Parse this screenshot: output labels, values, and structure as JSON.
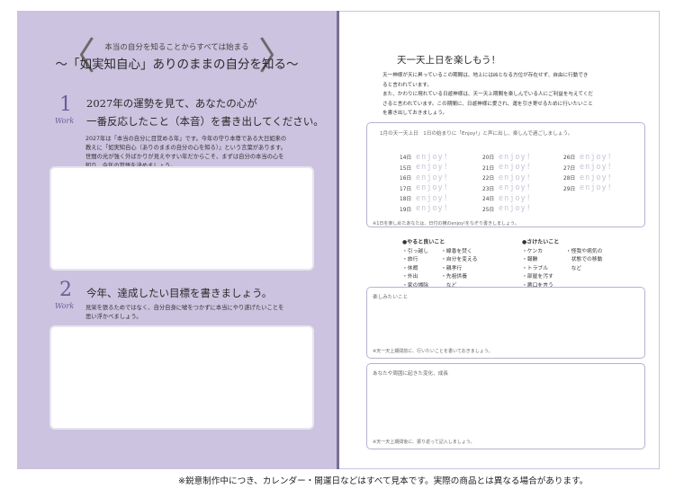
{
  "left_page": {
    "subtitle": "本当の自分を知ることからすべては始まる",
    "title": "〜「如実知自心」ありのままの自分を知る〜",
    "work1": {
      "number": "1",
      "label": "Work",
      "heading_line1": "2027年の運勢を見て、あなたの心が",
      "heading_line2": "一番反応したこと（本音）を書き出してください。",
      "body": [
        "2027年は「本当の自分に目覚める年」です。今年の守り本尊である大日如来の",
        "教えに「如実知自心（ありのままの自分の心を知る）」という言葉があります。",
        "世間の光が強く外ばかりが見えやすい年だからこそ、まずは自分の本当の心を",
        "知り、今年の覚悟を決めましょう。"
      ]
    },
    "work2": {
      "number": "2",
      "label": "Work",
      "heading": "今年、達成したい目標を書きましょう。",
      "body": [
        "見栄を張るためではなく、自分自身に嘘をつかずに本当にやり遂げたいことを",
        "思い浮かべましょう。"
      ]
    }
  },
  "right_page": {
    "title": "天一天上日を楽しもう！",
    "intro": [
      "天一神様が天に昇っているこの期間は、地上には凶となる方位が存在せず、自由に行動でき",
      "ると言われています。",
      "また、かわりに現れている日遊神様は、天一天上期間を楽しんでいる人にご利益を与えてくだ",
      "さると言われています。この期間に、日遊神様に愛され、運を引き寄せるために行いたいこと",
      "を書き出しておきましょう。"
    ],
    "calendar": {
      "header": "1月の天一天上日　1日の始まりに「Enjoy!」と声に出し、楽しんで過ごしましょう。",
      "enjoy_text": "enjoy!",
      "col1": [
        "14日",
        "15日",
        "16日",
        "17日",
        "18日",
        "19日"
      ],
      "col2": [
        "20日",
        "21日",
        "22日",
        "23日",
        "24日",
        "25日"
      ],
      "col3": [
        "26日",
        "27日",
        "28日",
        "29日"
      ],
      "note": "※1日を楽しめたあなたは、日付の横のenjoy!をなぞり書きしましょう。"
    },
    "good_list": {
      "title": "●やると良いこと",
      "col1": [
        "・引っ越し",
        "・旅行",
        "・休暇",
        "・外出",
        "・家の掃除"
      ],
      "col2": [
        "・線香を焚く",
        "・自分を変える",
        "・親孝行",
        "・先祖供養",
        "　など"
      ]
    },
    "avoid_list": {
      "title": "●さけたいこと",
      "col1": [
        "・ケンカ",
        "・報酬",
        "・トラブル",
        "・部屋を汚す",
        "・悪口を言う"
      ],
      "col2": [
        "・怪我や病気の",
        "　状態での移動",
        "　など"
      ]
    },
    "memo1": {
      "label": "楽しみたいこと",
      "note": "※天一天上期間前に、行いたいことを書いておきましょう。"
    },
    "memo2": {
      "label": "あなたや周囲に起きた変化、成長",
      "note": "※天一天上期間後に、振り返って記入しましょう。"
    }
  },
  "footnote": "※鋭意制作中につき、カレンダー・開運日などはすべて見本です。実際の商品とは異なる場合があります。"
}
